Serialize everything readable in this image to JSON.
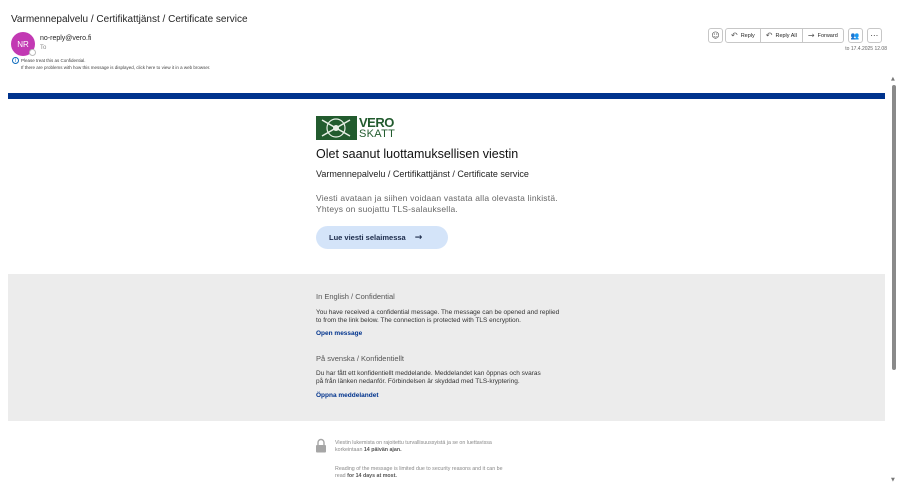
{
  "email": {
    "subject": "Varmennepalvelu / Certifikattjänst / Certificate service",
    "sender_initials": "NR",
    "sender": "no-reply@vero.fi",
    "to_label": "To",
    "info_line1": "Please treat this as Confidential.",
    "info_line2": "If there are problems with how this message is displayed, click here to view it in a web browser.",
    "datetime": "to 17.4.2025 12.08"
  },
  "toolbar": {
    "reply": "Reply",
    "reply_all": "Reply All",
    "forward": "Forward"
  },
  "logo": {
    "line1": "VERO",
    "line2": "SKATT"
  },
  "message": {
    "headline": "Olet saanut luottamuksellisen viestin",
    "service": "Varmennepalvelu / Certifikattjänst / Certificate service",
    "desc_line1": "Viesti avataan ja siihen voidaan vastata alla olevasta linkistä.",
    "desc_line2": "Yhteys on suojattu TLS-salauksella.",
    "cta_label": "Lue viesti selaimessa",
    "cta_arrow": "→"
  },
  "english": {
    "heading": "In English / Confidential",
    "body_line1": "You have received a confidential message. The message can be opened and replied",
    "body_line2": "to from the link below. The connection is protected with TLS encryption.",
    "link": "Open message"
  },
  "swedish": {
    "heading": "På svenska / Konfidentiellt",
    "body_line1": "Du har fått ett konfidentiellt meddelande. Meddelandet kan öppnas och svaras",
    "body_line2": "på från länken nedanför. Förbindelsen är skyddad med TLS-kryptering.",
    "link": "Öppna meddelandet"
  },
  "footer": {
    "fi_line1": "Viestin lukemista on rajoitettu turvallisuussyistä ja se on luettavissa",
    "fi_line2_pre": "korkeintaan ",
    "fi_line2_bold": "14 päivän ajan.",
    "en_line1": "Reading of the message is limited due to security reasons and it can be",
    "en_line2_pre": "read ",
    "en_line2_bold": "for 14 days at most."
  },
  "colors": {
    "banner": "#00338d",
    "avatar": "#c239b3",
    "logo_green": "#225b2e",
    "cta_bg": "#d4e4f9"
  },
  "icons": [
    "emoji-icon",
    "reply-icon",
    "reply-all-icon",
    "forward-icon",
    "teams-icon",
    "more-icon",
    "info-icon",
    "lock-icon"
  ]
}
